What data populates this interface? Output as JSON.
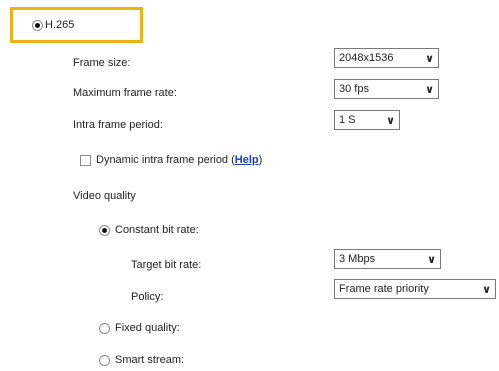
{
  "codec": {
    "label": "H.265",
    "selected": true
  },
  "frame_size": {
    "label": "Frame size:",
    "value": "2048x1536"
  },
  "max_frame_rate": {
    "label": "Maximum frame rate:",
    "value": "30 fps"
  },
  "intra_frame_period": {
    "label": "Intra frame period:",
    "value": "1 S"
  },
  "dynamic_intra": {
    "label": "Dynamic intra frame period (",
    "help": "Help",
    "close": ")",
    "checked": false
  },
  "video_quality": {
    "label": "Video quality",
    "cbr": {
      "label": "Constant bit rate:",
      "selected": true
    },
    "target_bit_rate": {
      "label": "Target bit rate:",
      "value": "3 Mbps"
    },
    "policy": {
      "label": "Policy:",
      "value": "Frame rate priority"
    },
    "fixed_quality": {
      "label": "Fixed quality:",
      "selected": false
    },
    "smart_stream": {
      "label": "Smart stream:",
      "selected": false
    }
  },
  "colors": {
    "highlight": "#eeb215",
    "link": "#1a3fb4"
  },
  "icons": {
    "dropdown": "chevron-down-icon"
  }
}
